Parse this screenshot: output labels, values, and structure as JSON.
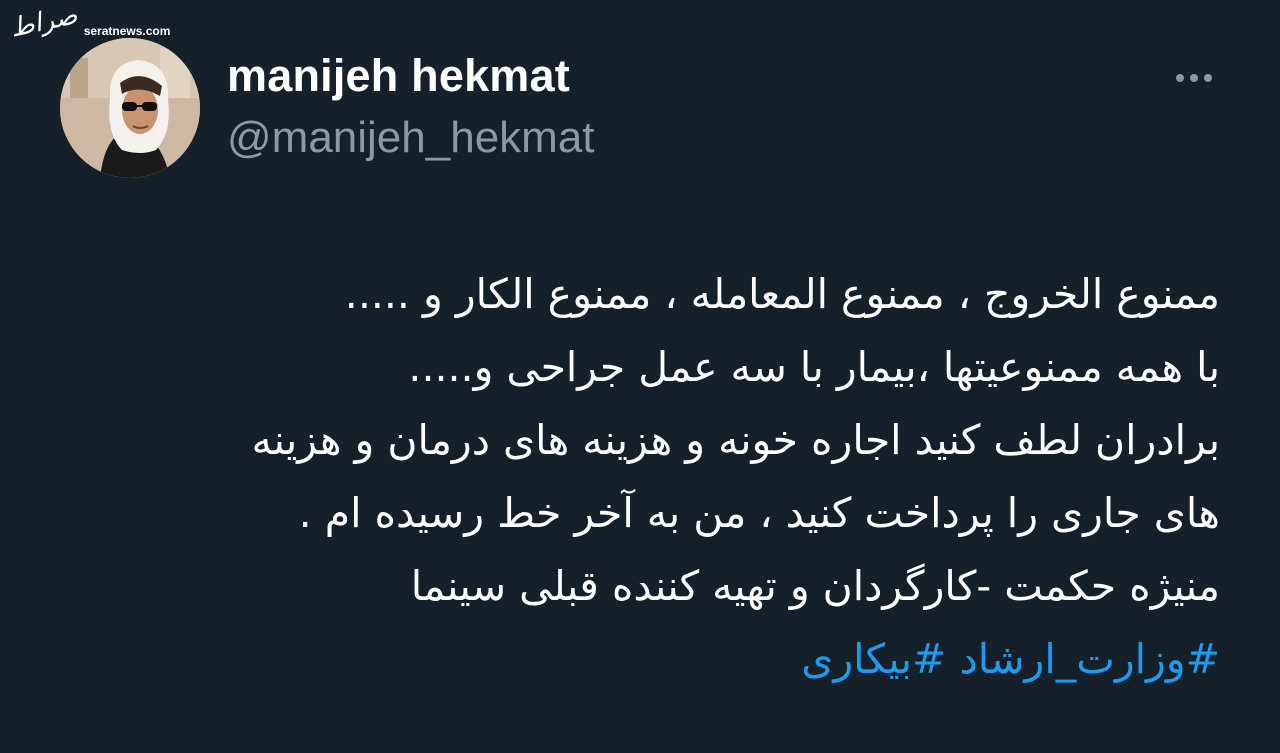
{
  "watermark": {
    "logo": "صراط",
    "site": "seratnews.com"
  },
  "author": {
    "display_name": "manijeh hekmat",
    "handle": "@manijeh_hekmat",
    "avatar_icon": "profile-photo"
  },
  "actions": {
    "more_icon": "more-horizontal-icon"
  },
  "tweet": {
    "lines": [
      "ممنوع الخروج ، ممنوع المعامله ، ممنوع الکار و .....",
      "با همه ممنوعیتها ،بیمار با سه عمل جراحی و.....",
      "برادران لطف کنید اجاره خونه و هزینه های درمان و هزینه",
      "های جاری را پرداخت کنید ، من به آخر خط رسیده ام .",
      "منیژه حکمت -کارگردان و تهیه کننده قبلی سینما"
    ],
    "hashtags": [
      "#وزارت_ارشاد",
      "#بیکاری"
    ]
  },
  "colors": {
    "background": "#15202b",
    "text": "#ffffff",
    "secondary_text": "#8b98a5",
    "link": "#1d9bf0"
  }
}
